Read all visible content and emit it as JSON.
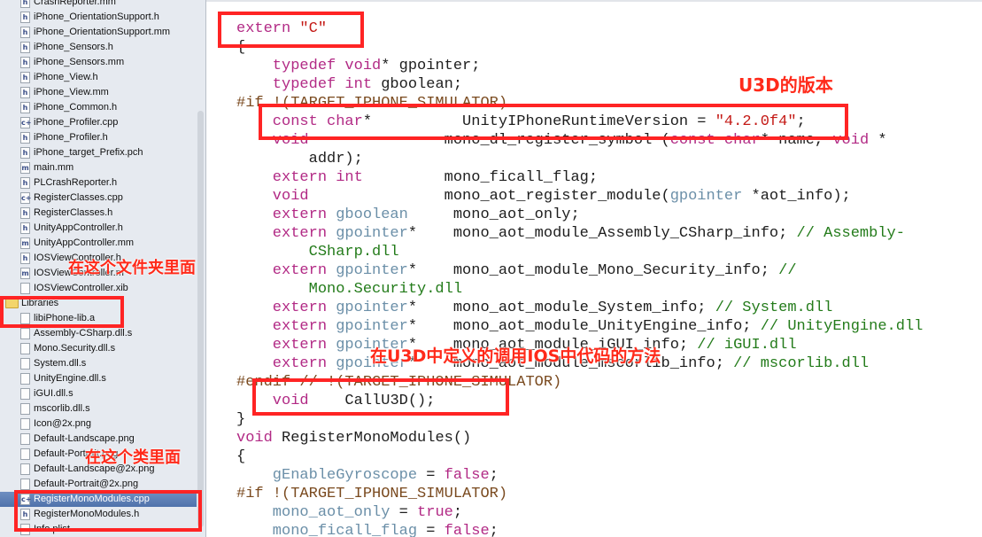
{
  "sidebar": {
    "files": [
      {
        "name": "CrashReporter.mm",
        "icon": "h-file-icon"
      },
      {
        "name": "iPhone_OrientationSupport.h",
        "icon": "h-file-icon"
      },
      {
        "name": "iPhone_OrientationSupport.mm",
        "icon": "h-file-icon"
      },
      {
        "name": "iPhone_Sensors.h",
        "icon": "h-file-icon"
      },
      {
        "name": "iPhone_Sensors.mm",
        "icon": "h-file-icon"
      },
      {
        "name": "iPhone_View.h",
        "icon": "h-file-icon"
      },
      {
        "name": "iPhone_View.mm",
        "icon": "h-file-icon"
      },
      {
        "name": "iPhone_Common.h",
        "icon": "h-file-icon"
      },
      {
        "name": "iPhone_Profiler.cpp",
        "icon": "cpp-file-icon"
      },
      {
        "name": "iPhone_Profiler.h",
        "icon": "h-file-icon"
      },
      {
        "name": "iPhone_target_Prefix.pch",
        "icon": "h-file-icon"
      },
      {
        "name": "main.mm",
        "icon": "m-file-icon"
      },
      {
        "name": "PLCrashReporter.h",
        "icon": "h-file-icon"
      },
      {
        "name": "RegisterClasses.cpp",
        "icon": "cpp-file-icon"
      },
      {
        "name": "RegisterClasses.h",
        "icon": "h-file-icon"
      },
      {
        "name": "UnityAppController.h",
        "icon": "h-file-icon"
      },
      {
        "name": "UnityAppController.mm",
        "icon": "m-file-icon"
      },
      {
        "name": "IOSViewController.h",
        "icon": "h-file-icon"
      },
      {
        "name": "IOSViewController.m",
        "icon": "m-file-icon"
      },
      {
        "name": "IOSViewController.xib",
        "icon": "xib-file-icon"
      },
      {
        "name": "Libraries",
        "icon": "folder-icon",
        "folder": true
      },
      {
        "name": "libiPhone-lib.a",
        "icon": "lib-file-icon"
      },
      {
        "name": "Assembly-CSharp.dll.s",
        "icon": "s-file-icon"
      },
      {
        "name": "Mono.Security.dll.s",
        "icon": "s-file-icon"
      },
      {
        "name": "System.dll.s",
        "icon": "s-file-icon"
      },
      {
        "name": "UnityEngine.dll.s",
        "icon": "s-file-icon"
      },
      {
        "name": "iGUI.dll.s",
        "icon": "s-file-icon"
      },
      {
        "name": "mscorlib.dll.s",
        "icon": "s-file-icon"
      },
      {
        "name": "Icon@2x.png",
        "icon": "image-file-icon"
      },
      {
        "name": "Default-Landscape.png",
        "icon": "image-file-icon"
      },
      {
        "name": "Default-Portrait.png",
        "icon": "image-file-icon"
      },
      {
        "name": "Default-Landscape@2x.png",
        "icon": "image-file-icon"
      },
      {
        "name": "Default-Portrait@2x.png",
        "icon": "image-file-icon"
      },
      {
        "name": "RegisterMonoModules.cpp",
        "icon": "cpp-file-icon",
        "selected": true
      },
      {
        "name": "RegisterMonoModules.h",
        "icon": "h-file-icon"
      },
      {
        "name": "Info.plist",
        "icon": "plist-file-icon"
      }
    ]
  },
  "editor": {
    "lines": [
      [
        {
          "t": "extern ",
          "c": "kw"
        },
        {
          "t": "\"C\"",
          "c": "str"
        }
      ],
      [
        {
          "t": "{",
          "c": "pl"
        }
      ],
      [
        {
          "t": "    typedef ",
          "c": "kw"
        },
        {
          "t": "void",
          "c": "kw"
        },
        {
          "t": "* gpointer;",
          "c": "pl"
        }
      ],
      [
        {
          "t": "    typedef ",
          "c": "kw"
        },
        {
          "t": "int",
          "c": "kw"
        },
        {
          "t": " gboolean;",
          "c": "pl"
        }
      ],
      [
        {
          "t": "#if !(TARGET_IPHONE_SIMULATOR)",
          "c": "pp"
        }
      ],
      [
        {
          "t": "    const ",
          "c": "kw"
        },
        {
          "t": "char",
          "c": "kw"
        },
        {
          "t": "*          UnityIPhoneRuntimeVersion = ",
          "c": "pl"
        },
        {
          "t": "\"4.2.0f4\"",
          "c": "str"
        },
        {
          "t": ";",
          "c": "pl"
        }
      ],
      [
        {
          "t": "    void",
          "c": "kw"
        },
        {
          "t": "               mono_dl_register_symbol (",
          "c": "pl"
        },
        {
          "t": "const ",
          "c": "kw"
        },
        {
          "t": "char",
          "c": "kw"
        },
        {
          "t": "* name, ",
          "c": "pl"
        },
        {
          "t": "void",
          "c": "kw"
        },
        {
          "t": " *",
          "c": "pl"
        }
      ],
      [
        {
          "t": "        addr);",
          "c": "pl"
        }
      ],
      [
        {
          "t": "    extern ",
          "c": "kw"
        },
        {
          "t": "int",
          "c": "kw"
        },
        {
          "t": "         mono_ficall_flag;",
          "c": "pl"
        }
      ],
      [
        {
          "t": "    void",
          "c": "kw"
        },
        {
          "t": "               mono_aot_register_module(",
          "c": "pl"
        },
        {
          "t": "gpointer",
          "c": "ty"
        },
        {
          "t": " *aot_info);",
          "c": "pl"
        }
      ],
      [
        {
          "t": "    extern ",
          "c": "kw"
        },
        {
          "t": "gboolean",
          "c": "ty"
        },
        {
          "t": "     mono_aot_only;",
          "c": "pl"
        }
      ],
      [
        {
          "t": "    extern ",
          "c": "kw"
        },
        {
          "t": "gpointer",
          "c": "ty"
        },
        {
          "t": "*    mono_aot_module_Assembly_CSharp_info; ",
          "c": "pl"
        },
        {
          "t": "// Assembly-",
          "c": "cm"
        }
      ],
      [
        {
          "t": "        CSharp.dll",
          "c": "cm"
        }
      ],
      [
        {
          "t": "    extern ",
          "c": "kw"
        },
        {
          "t": "gpointer",
          "c": "ty"
        },
        {
          "t": "*    mono_aot_module_Mono_Security_info; ",
          "c": "pl"
        },
        {
          "t": "//",
          "c": "cm"
        }
      ],
      [
        {
          "t": "        Mono.Security.dll",
          "c": "cm"
        }
      ],
      [
        {
          "t": "    extern ",
          "c": "kw"
        },
        {
          "t": "gpointer",
          "c": "ty"
        },
        {
          "t": "*    mono_aot_module_System_info; ",
          "c": "pl"
        },
        {
          "t": "// System.dll",
          "c": "cm"
        }
      ],
      [
        {
          "t": "    extern ",
          "c": "kw"
        },
        {
          "t": "gpointer",
          "c": "ty"
        },
        {
          "t": "*    mono_aot_module_UnityEngine_info; ",
          "c": "pl"
        },
        {
          "t": "// UnityEngine.dll",
          "c": "cm"
        }
      ],
      [
        {
          "t": "    extern ",
          "c": "kw"
        },
        {
          "t": "gpointer",
          "c": "ty"
        },
        {
          "t": "*    mono_aot_module_iGUI_info; ",
          "c": "pl"
        },
        {
          "t": "// iGUI.dll",
          "c": "cm"
        }
      ],
      [
        {
          "t": "    extern ",
          "c": "kw"
        },
        {
          "t": "gpointer",
          "c": "ty"
        },
        {
          "t": "*    mono_aot_module_mscorlib_info; ",
          "c": "pl"
        },
        {
          "t": "// mscorlib.dll",
          "c": "cm"
        }
      ],
      [
        {
          "t": "#endif // !(TARGET_IPHONE_SIMULATOR)",
          "c": "pp"
        }
      ],
      [
        {
          "t": "    void",
          "c": "kw"
        },
        {
          "t": "    CallU3D();",
          "c": "pl"
        }
      ],
      [
        {
          "t": "}",
          "c": "pl"
        }
      ],
      [
        {
          "t": "void",
          "c": "kw"
        },
        {
          "t": " RegisterMonoModules()",
          "c": "pl"
        }
      ],
      [
        {
          "t": "{",
          "c": "pl"
        }
      ],
      [
        {
          "t": "    gEnableGyroscope",
          "c": "ty"
        },
        {
          "t": " = ",
          "c": "pl"
        },
        {
          "t": "false",
          "c": "kw"
        },
        {
          "t": ";",
          "c": "pl"
        }
      ],
      [
        {
          "t": "#if !(TARGET_IPHONE_SIMULATOR)",
          "c": "pp"
        }
      ],
      [
        {
          "t": "    mono_aot_only",
          "c": "ty"
        },
        {
          "t": " = ",
          "c": "pl"
        },
        {
          "t": "true",
          "c": "kw"
        },
        {
          "t": ";",
          "c": "pl"
        }
      ],
      [
        {
          "t": "    mono_ficall_flag",
          "c": "ty"
        },
        {
          "t": " = ",
          "c": "pl"
        },
        {
          "t": "false",
          "c": "kw"
        },
        {
          "t": ";",
          "c": "pl"
        }
      ]
    ]
  },
  "annotations": {
    "u3d_version": "U3D的版本",
    "in_folder": "在这个文件夹里面",
    "in_class": "在这个类里面",
    "call_method": "在U3D中定义的调用IOS中代码的方法",
    "color": "#ff2424"
  }
}
